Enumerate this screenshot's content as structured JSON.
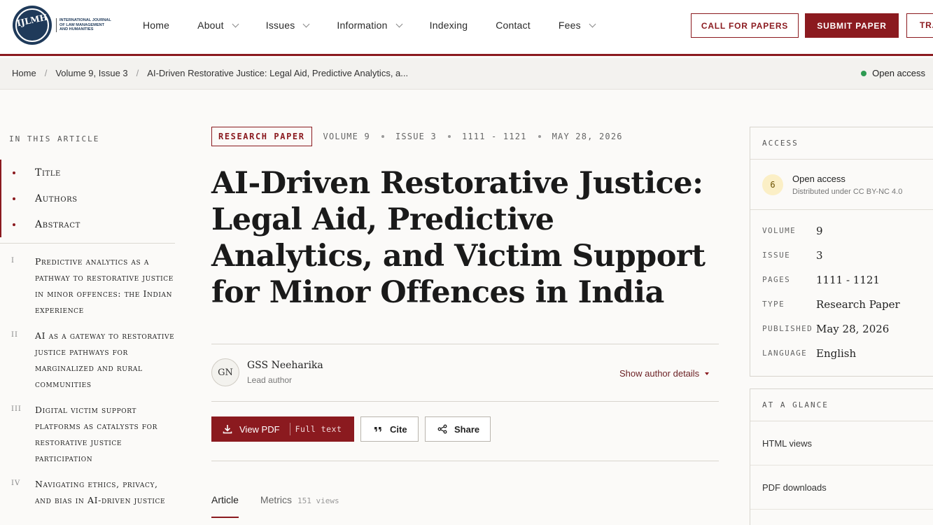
{
  "logo": {
    "mark": "IJLMH",
    "text": "International Journal of Law Management and Humanities"
  },
  "nav": {
    "items": [
      {
        "label": "Home",
        "dropdown": false
      },
      {
        "label": "About",
        "dropdown": true
      },
      {
        "label": "Issues",
        "dropdown": true
      },
      {
        "label": "Information",
        "dropdown": true
      },
      {
        "label": "Indexing",
        "dropdown": false
      },
      {
        "label": "Contact",
        "dropdown": false
      },
      {
        "label": "Fees",
        "dropdown": true
      }
    ],
    "call_for_papers": "CALL FOR PAPERS",
    "submit_paper": "SUBMIT PAPER",
    "cut_button": "TRA"
  },
  "breadcrumb": {
    "items": [
      "Home",
      "Volume 9, Issue 3",
      "AI-Driven Restorative Justice: Legal Aid, Predictive Analytics, a..."
    ],
    "open_access": "Open access"
  },
  "toc": {
    "heading": "IN THIS ARTICLE",
    "main": [
      "Title",
      "Authors",
      "Abstract"
    ],
    "sections": [
      {
        "num": "I",
        "text": "Predictive analytics as a pathway to restorative justice in minor offences: the Indian experience"
      },
      {
        "num": "II",
        "text": "AI as a gateway to restorative justice pathways for marginalized and rural communities"
      },
      {
        "num": "III",
        "text": "Digital victim support platforms as catalysts for restorative justice participation"
      },
      {
        "num": "IV",
        "text": "Navigating ethics, privacy, and bias in AI-driven justice"
      }
    ]
  },
  "article": {
    "tag": "RESEARCH PAPER",
    "meta": [
      "VOLUME 9",
      "ISSUE 3",
      "1111 - 1121",
      "MAY 28, 2026"
    ],
    "title": "AI-Driven Restorative Justice: Legal Aid, Predictive Analytics, and Victim Support for Minor Offences in India",
    "author": {
      "initials": "GN",
      "name": "GSS Neeharika",
      "role": "Lead author"
    },
    "show_author_details": "Show author details",
    "view_pdf": "View PDF",
    "full_text": "Full text",
    "cite": "Cite",
    "share": "Share",
    "tabs": {
      "article": "Article",
      "metrics": "Metrics",
      "views": "151 views"
    }
  },
  "access_panel": {
    "heading": "ACCESS",
    "badge": "6",
    "open_access": "Open access",
    "license": "Distributed under CC BY-NC 4.0",
    "details": [
      {
        "k": "VOLUME",
        "v": "9"
      },
      {
        "k": "ISSUE",
        "v": "3"
      },
      {
        "k": "PAGES",
        "v": "1111 - 1121"
      },
      {
        "k": "TYPE",
        "v": "Research Paper"
      },
      {
        "k": "PUBLISHED",
        "v": "May 28, 2026"
      },
      {
        "k": "LANGUAGE",
        "v": "English"
      }
    ]
  },
  "glance_panel": {
    "heading": "AT A GLANCE",
    "rows": [
      "HTML views",
      "PDF downloads"
    ]
  },
  "colors": {
    "accent": "#8b1a1f",
    "open_access_dot": "#2f9b53"
  }
}
